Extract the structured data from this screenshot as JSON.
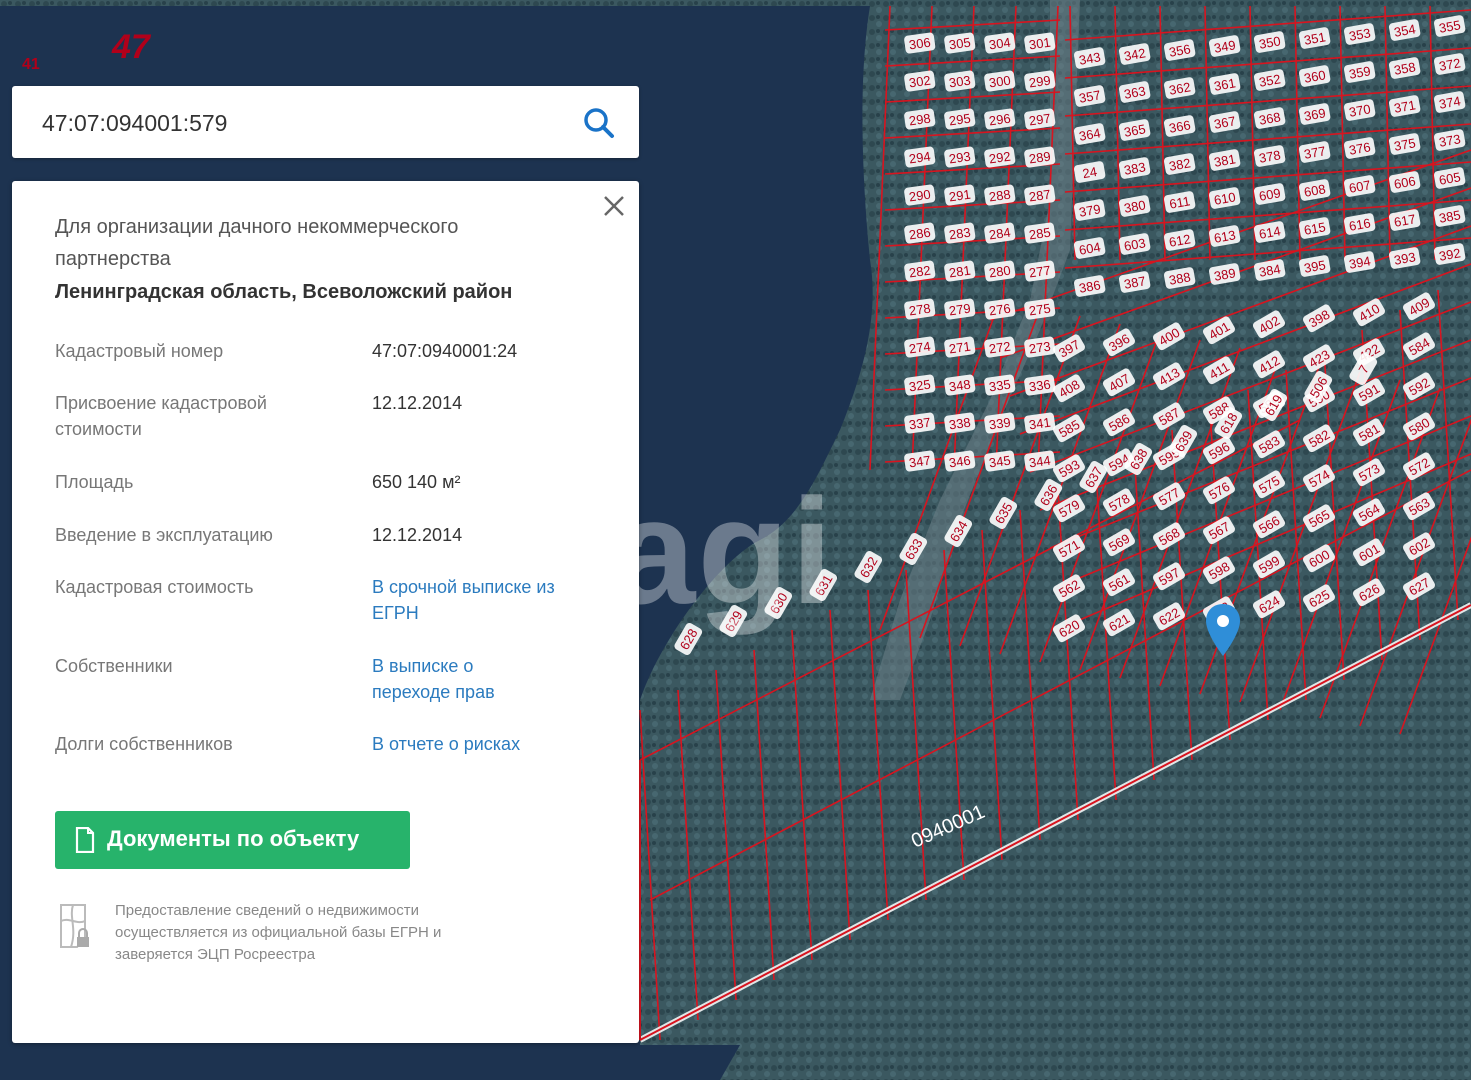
{
  "search": {
    "value": "47:07:094001:579"
  },
  "map": {
    "region_code_large": "47",
    "region_code_small": "41",
    "quarter_label": "0940001",
    "watermark": "tagi",
    "plot_numbers": [
      "306",
      "305",
      "304",
      "301",
      "302",
      "303",
      "300",
      "299",
      "298",
      "295",
      "296",
      "297",
      "294",
      "293",
      "292",
      "289",
      "290",
      "291",
      "288",
      "287",
      "286",
      "283",
      "284",
      "285",
      "282",
      "281",
      "280",
      "277",
      "278",
      "279",
      "276",
      "275",
      "274",
      "271",
      "272",
      "273",
      "325",
      "348",
      "335",
      "336",
      "337",
      "338",
      "339",
      "341",
      "347",
      "346",
      "345",
      "344",
      "343",
      "342",
      "356",
      "349",
      "350",
      "351",
      "353",
      "354",
      "355",
      "357",
      "363",
      "362",
      "361",
      "352",
      "360",
      "359",
      "358",
      "372",
      "364",
      "365",
      "366",
      "367",
      "368",
      "369",
      "370",
      "371",
      "374",
      "24",
      "383",
      "382",
      "381",
      "378",
      "377",
      "376",
      "375",
      "373",
      "379",
      "380",
      "611",
      "610",
      "609",
      "608",
      "607",
      "606",
      "605",
      "604",
      "603",
      "612",
      "613",
      "614",
      "615",
      "616",
      "617",
      "385",
      "386",
      "387",
      "388",
      "389",
      "384",
      "395",
      "394",
      "393",
      "392",
      "397",
      "396",
      "400",
      "401",
      "402",
      "398",
      "410",
      "409",
      "408",
      "407",
      "413",
      "411",
      "412",
      "423",
      "422",
      "584",
      "585",
      "586",
      "587",
      "588",
      "589",
      "590",
      "591",
      "592",
      "593",
      "594",
      "595",
      "596",
      "583",
      "582",
      "581",
      "580",
      "579",
      "578",
      "577",
      "576",
      "575",
      "574",
      "573",
      "572",
      "571",
      "569",
      "568",
      "567",
      "566",
      "565",
      "564",
      "563",
      "562",
      "561",
      "597",
      "598",
      "599",
      "600",
      "601",
      "602",
      "620",
      "621",
      "622",
      "623",
      "624",
      "625",
      "626",
      "627",
      "628",
      "629",
      "630",
      "631",
      "632",
      "633",
      "634",
      "635",
      "636",
      "637",
      "638",
      "639",
      "618",
      "619",
      "506",
      "7"
    ],
    "colors": {
      "water": "#1d3350",
      "forest": "#34505a",
      "cadastre_line": "#d8141f",
      "label_text": "#b1001a"
    }
  },
  "card": {
    "close_icon": "close-icon",
    "purpose": "Для организации дачного некоммерческого партнерства",
    "address": "Ленинградская область, Всеволожский район",
    "rows": [
      {
        "label": "Кадастровый номер",
        "value": "47:07:0940001:24"
      },
      {
        "label": "Присвоение кадастровой стоимости",
        "value": "12.12.2014"
      },
      {
        "label": "Площадь",
        "value": "650 140 м²"
      },
      {
        "label": "Введение в эксплуатацию",
        "value": "12.12.2014"
      },
      {
        "label": "Кадастровая стоимость",
        "value": "В срочной выписке из ЕГРН"
      },
      {
        "label": "Собственники",
        "value": "В выписке о переходе прав"
      },
      {
        "label": "Долги собственников",
        "value": "В отчете о рисках"
      }
    ],
    "documents_button": "Документы по объекту",
    "footnote": "Предоставление сведений о недвижимости осуществляется из официальной базы ЕГРН и заверяется ЭЦП Росреестра",
    "accent": "#27b36b",
    "link_color": "#2b7bbf"
  }
}
